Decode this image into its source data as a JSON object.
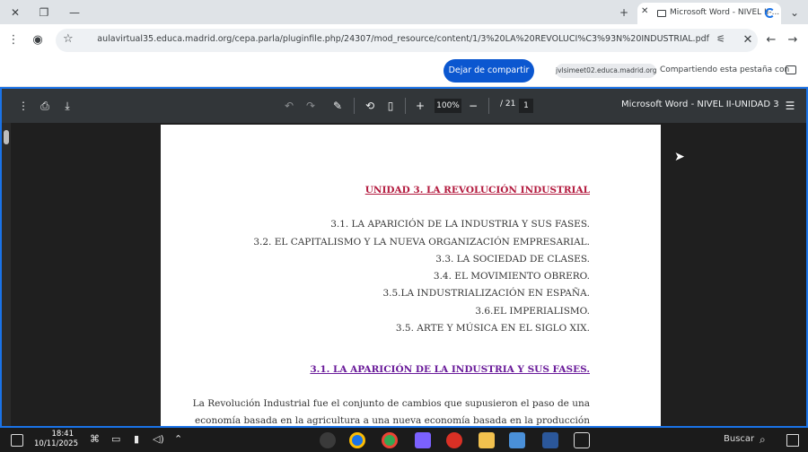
{
  "browser": {
    "tab_title": "Microsoft Word - NIVEL II-...",
    "url": "aulavirtual35.educa.madrid.org/cepa.parla/pluginfile.php/24307/mod_resource/content/1/3%20LA%20REVOLUCI%C3%93N%20INDUSTRIAL.pdf"
  },
  "sharebar": {
    "stop_button": "Dejar de compartir",
    "shared_host": "jvlsimeet02.educa.madrid.org",
    "message": "Compartiendo esta pestaña con"
  },
  "pdf_viewer": {
    "doc_title": "Microsoft Word - NIVEL II-UNIDAD 3",
    "current_page": "1",
    "page_total": "/ 21",
    "zoom": "100%"
  },
  "page": {
    "heading_main": "UNIDAD 3. LA REVOLUCIÓN INDUSTRIAL",
    "toc": [
      "3.1. LA APARICIÓN DE LA INDUSTRIA Y SUS FASES.",
      "3.2. EL CAPITALISMO Y LA NUEVA ORGANIZACIÓN EMPRESARIAL.",
      "3.3. LA SOCIEDAD DE CLASES.",
      "3.4. EL MOVIMIENTO OBRERO.",
      "3.5.LA INDUSTRIALIZACIÓN EN ESPAÑA.",
      "3.6.EL IMPERIALISMO.",
      "3.5. ARTE Y MÚSICA EN EL SIGLO XIX."
    ],
    "heading_section": "3.1. LA APARICIÓN DE LA INDUSTRIA Y SUS FASES.",
    "paragraph": [
      "La Revolución Industrial fue el conjunto de cambios que supusieron el paso de una",
      "economía basada en la agricultura a una nueva economía basada en la producción"
    ]
  },
  "taskbar": {
    "search_label": "Buscar",
    "time": "18:41",
    "date": "10/11/2025"
  }
}
